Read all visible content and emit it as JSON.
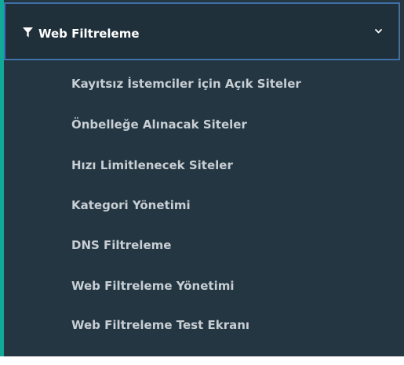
{
  "menu": {
    "header": {
      "icon": "filter-icon",
      "label": "Web Filtreleme",
      "expanded": true,
      "toggle_icon": "chevron-down-icon"
    },
    "items": [
      {
        "label": "Kayıtsız İstemciler için Açık Siteler"
      },
      {
        "label": "Önbelleğe Alınacak Siteler"
      },
      {
        "label": "Hızı Limitlenecek Siteler"
      },
      {
        "label": "Kategori Yönetimi"
      },
      {
        "label": "DNS Filtreleme"
      },
      {
        "label": "Web Filtreleme Yönetimi"
      },
      {
        "label": "Web Filtreleme Test Ekranı"
      }
    ]
  },
  "colors": {
    "sidebar_bg": "#243642",
    "header_bg": "#1f303b",
    "header_border": "#3f70a8",
    "accent": "#11a997",
    "item_text": "#c7ced4",
    "header_text": "#ffffff"
  }
}
